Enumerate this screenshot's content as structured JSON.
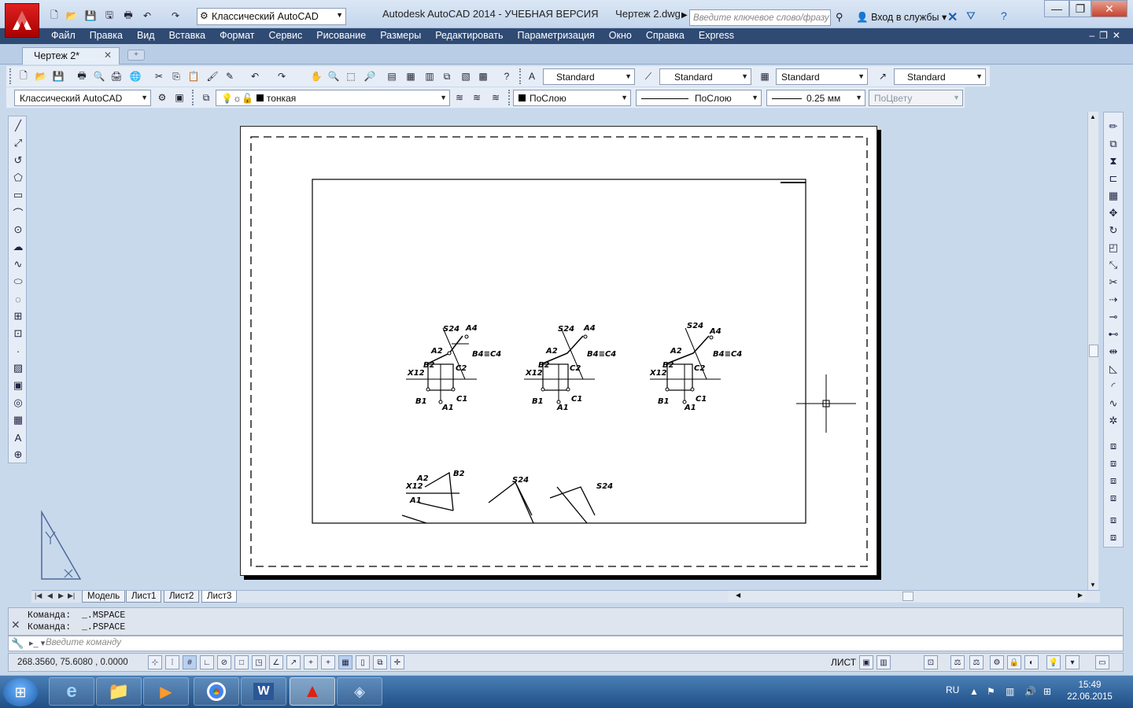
{
  "window": {
    "workspace": "Классический AutoCAD",
    "app_title": "Autodesk AutoCAD 2014 - УЧЕБНАЯ ВЕРСИЯ",
    "doc_title": "Чертеж 2.dwg",
    "search_placeholder": "Введите ключевое слово/фразу",
    "login": "Вход в службы"
  },
  "menu": [
    "Файл",
    "Правка",
    "Вид",
    "Вставка",
    "Формат",
    "Сервис",
    "Рисование",
    "Размеры",
    "Редактировать",
    "Параметризация",
    "Окно",
    "Справка",
    "Express"
  ],
  "doc_tab": "Чертеж 2*",
  "styles": {
    "text_style": "Standard",
    "dim_style": "Standard",
    "table_style": "Standard",
    "mleader_style": "Standard"
  },
  "layers": {
    "workspace": "Классический AutoCAD",
    "layer": "тонкая",
    "color": "ПоСлою",
    "linetype": "ПоСлою",
    "lineweight": "0.25 мм",
    "plotstyle": "ПоЦвету"
  },
  "layout_tabs": [
    "Модель",
    "Лист1",
    "Лист2",
    "Лист3"
  ],
  "command": {
    "history": [
      "Команда:  _.MSPACE",
      "Команда:  _.PSPACE"
    ],
    "placeholder": "Введите команду"
  },
  "status": {
    "coords": "268.3560, 75.6080 , 0.0000",
    "space": "ЛИСТ"
  },
  "drawing_labels": {
    "s24": "S24",
    "a4": "A4",
    "a2": "A2",
    "b4c4": "B4≡C4",
    "b2": "B2",
    "c2": "C2",
    "x12": "X12",
    "b1": "B1",
    "a1": "A1",
    "c1": "C1"
  },
  "taskbar": {
    "lang": "RU",
    "time": "15:49",
    "date": "22.06.2015"
  },
  "colors": {
    "menubar": "#2f4a73",
    "canvas": "#c9d9ec",
    "taskbar": "#1f4f86"
  }
}
